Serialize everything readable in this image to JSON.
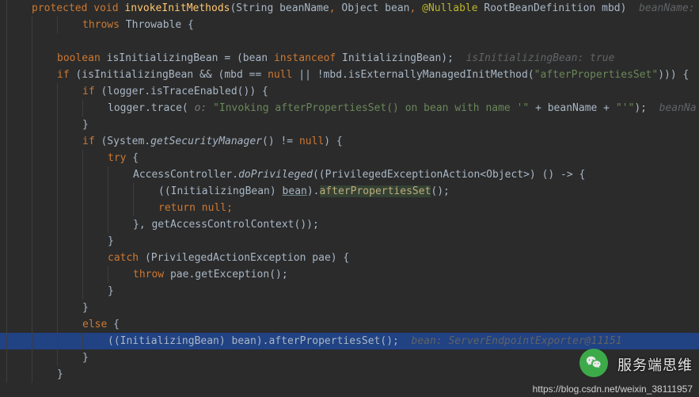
{
  "code": {
    "l1_protected": "protected",
    "l1_void": "void",
    "l1_method": "invokeInitMethods",
    "l1_p1": "(String beanName",
    "l1_c1": ",",
    "l1_p2": " Object bean",
    "l1_c2": ",",
    "l1_ann": "@Nullable",
    "l1_p3": " RootBeanDefinition mbd)",
    "l1_hint": "  beanName:",
    "l2_throws": "throws",
    "l2_ex": " Throwable {",
    "l4_boolean": "boolean",
    "l4_var": " isInitializingBean = (bean ",
    "l4_instanceof": "instanceof",
    "l4_rest": " InitializingBean);",
    "l4_hint": "  isInitializingBean: true",
    "l5_if": "if",
    "l5_cond_a": " (isInitializingBean && (mbd == ",
    "l5_null": "null",
    "l5_cond_b": " || !mbd.isExternallyManagedInitMethod(",
    "l5_str": "\"afterPropertiesSet\"",
    "l5_cond_c": "))) {",
    "l6_if": "if",
    "l6_cond": " (logger.isTraceEnabled()) {",
    "l7_logger": "logger",
    "l7_trace": ".trace(",
    "l7_hint": " o: ",
    "l7_str": "\"Invoking afterPropertiesSet() on bean with name '\"",
    "l7_plus1": " + beanName + ",
    "l7_str2": "\"'\"",
    "l7_end": ");",
    "l7_hint2": "  beanNa",
    "l8_brace": "}",
    "l9_if": "if",
    "l9_cond_a": " (System.",
    "l9_call": "getSecurityManager",
    "l9_cond_b": "() != ",
    "l9_null": "null",
    "l9_cond_c": ") {",
    "l10_try": "try",
    "l10_brace": " {",
    "l11_a": "AccessController.",
    "l11_call": "doPrivileged",
    "l11_b": "((PrivilegedExceptionAction<Object>) () -> {",
    "l12_a": "((InitializingBean) ",
    "l12_bean": "bean",
    "l12_b": ").",
    "l12_method": "afterPropertiesSet",
    "l12_c": "();",
    "l13_return": "return",
    "l13_null": " null",
    "l13_semi": ";",
    "l14_a": "}, getAccessControlContext());",
    "l15_brace": "}",
    "l16_catch": "catch",
    "l16_a": " (PrivilegedActionException pae) {",
    "l17_throw": "throw",
    "l17_a": " pae.getException();",
    "l18_brace": "}",
    "l19_brace": "}",
    "l20_else": "else",
    "l20_brace": " {",
    "l21_a": "((InitializingBean) bean).afterPropertiesSet();",
    "l21_hint": "  bean: ServerEndpointExporter@11151",
    "l22_brace": "}",
    "l23_brace": "}"
  },
  "watermark": {
    "text": "服务端思维",
    "url": "https://blog.csdn.net/weixin_38111957"
  }
}
